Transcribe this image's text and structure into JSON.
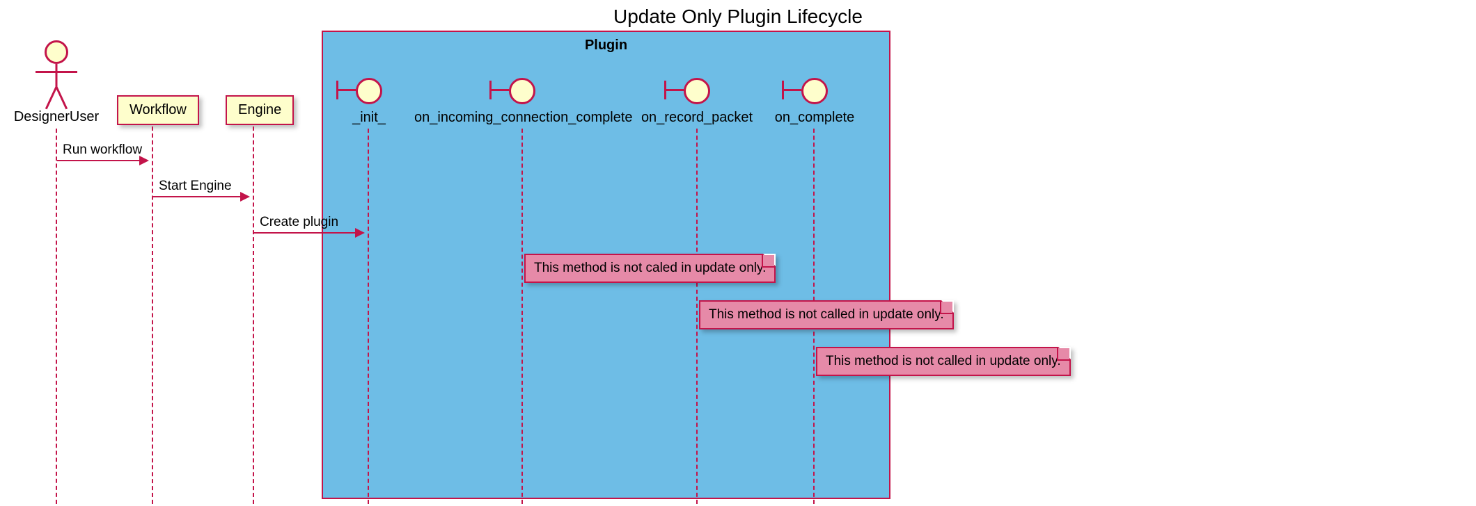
{
  "title": "Update Only Plugin Lifecycle",
  "actor": {
    "name": "DesignerUser"
  },
  "participants": {
    "workflow": "Workflow",
    "engine": "Engine"
  },
  "plugin": {
    "title": "Plugin",
    "entities": {
      "init": "_init_",
      "on_incoming": "on_incoming_connection_complete",
      "on_record": "on_record_packet",
      "on_complete": "on_complete"
    }
  },
  "messages": {
    "run_workflow": "Run workflow",
    "start_engine": "Start Engine",
    "create_plugin": "Create plugin"
  },
  "notes": {
    "note1": "This method is not caled in update only.",
    "note2": "This method is not called in update only.",
    "note3": "This method is not called in update only."
  }
}
